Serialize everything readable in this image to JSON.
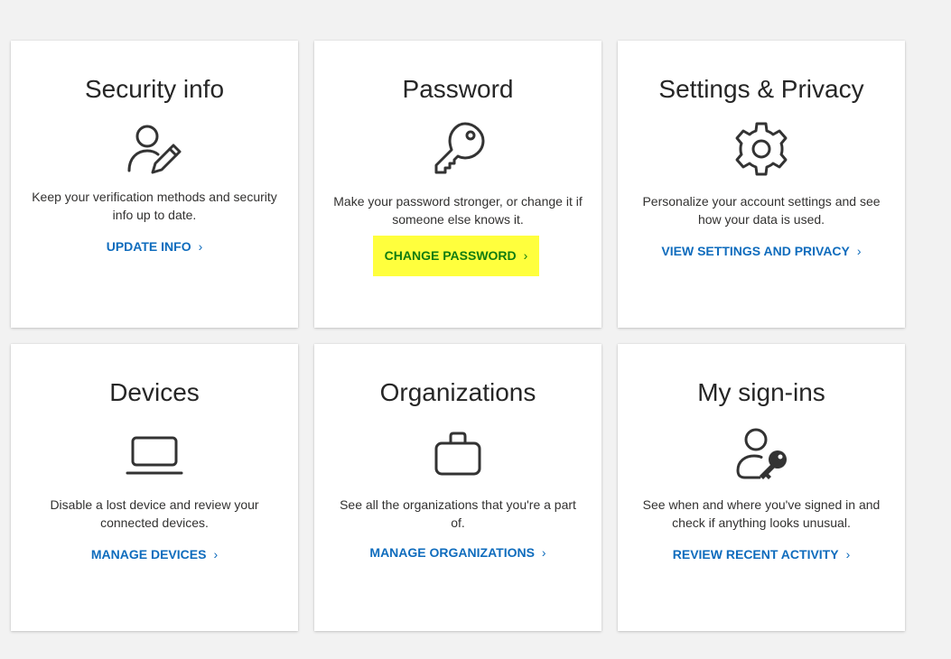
{
  "cards": [
    {
      "title": "Security info",
      "icon": "user-edit-icon",
      "description": "Keep your verification methods and security info up to date.",
      "link": "UPDATE INFO"
    },
    {
      "title": "Password",
      "icon": "key-icon",
      "description": "Make your password stronger, or change it if someone else knows it.",
      "link": "CHANGE PASSWORD"
    },
    {
      "title": "Settings & Privacy",
      "icon": "gear-icon",
      "description": "Personalize your account settings and see how your data is used.",
      "link": "VIEW SETTINGS AND PRIVACY"
    },
    {
      "title": "Devices",
      "icon": "laptop-icon",
      "description": "Disable a lost device and review your connected devices.",
      "link": "MANAGE DEVICES"
    },
    {
      "title": "Organizations",
      "icon": "briefcase-icon",
      "description": "See all the organizations that you're a part of.",
      "link": "MANAGE ORGANIZATIONS"
    },
    {
      "title": "My sign-ins",
      "icon": "user-key-icon",
      "description": "See when and where you've signed in and check if anything looks unusual.",
      "link": "REVIEW RECENT ACTIVITY"
    }
  ],
  "chevron": "›",
  "colors": {
    "link": "#0f6cbd",
    "highlight": "#ffff3d",
    "highlight_link": "#107c10",
    "title": "#262626",
    "background": "#f2f2f2"
  }
}
